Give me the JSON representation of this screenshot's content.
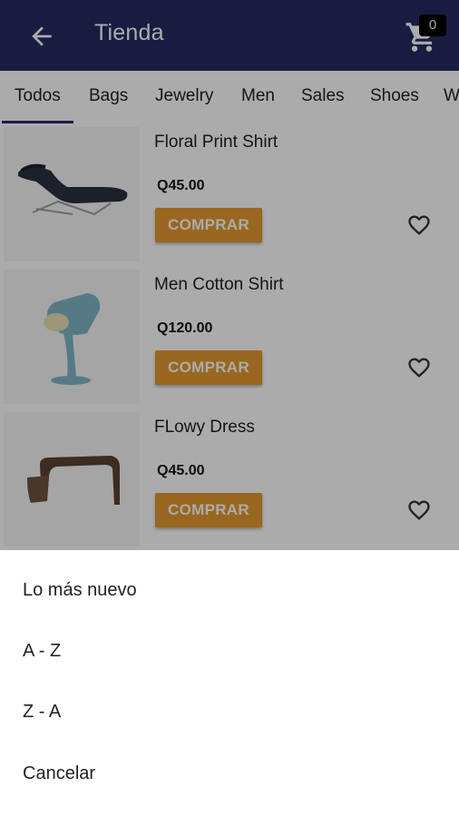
{
  "appbar": {
    "title": "Tienda",
    "back_icon": "arrow-back-icon",
    "cart_icon": "shopping-cart-icon",
    "cart_count": "0",
    "color": "#262b62"
  },
  "tabs": [
    "Todos",
    "Bags",
    "Jewelry",
    "Men",
    "Sales",
    "Shoes",
    "W"
  ],
  "active_tab": "Todos",
  "products": [
    {
      "name": "Floral Print Shirt",
      "price": "Q45.00",
      "button": "COMPRAR",
      "image": "lounge-chair"
    },
    {
      "name": "Men Cotton Shirt",
      "price": "Q120.00",
      "button": "COMPRAR",
      "image": "pouring-lamp"
    },
    {
      "name": "FLowy Dress",
      "price": "Q45.00",
      "button": "COMPRAR",
      "image": "wooden-side-table"
    }
  ],
  "accent": "#e59a2f",
  "sort_sheet": {
    "options": [
      "Lo más nuevo",
      "A - Z",
      "Z - A"
    ],
    "cancel": "Cancelar"
  }
}
